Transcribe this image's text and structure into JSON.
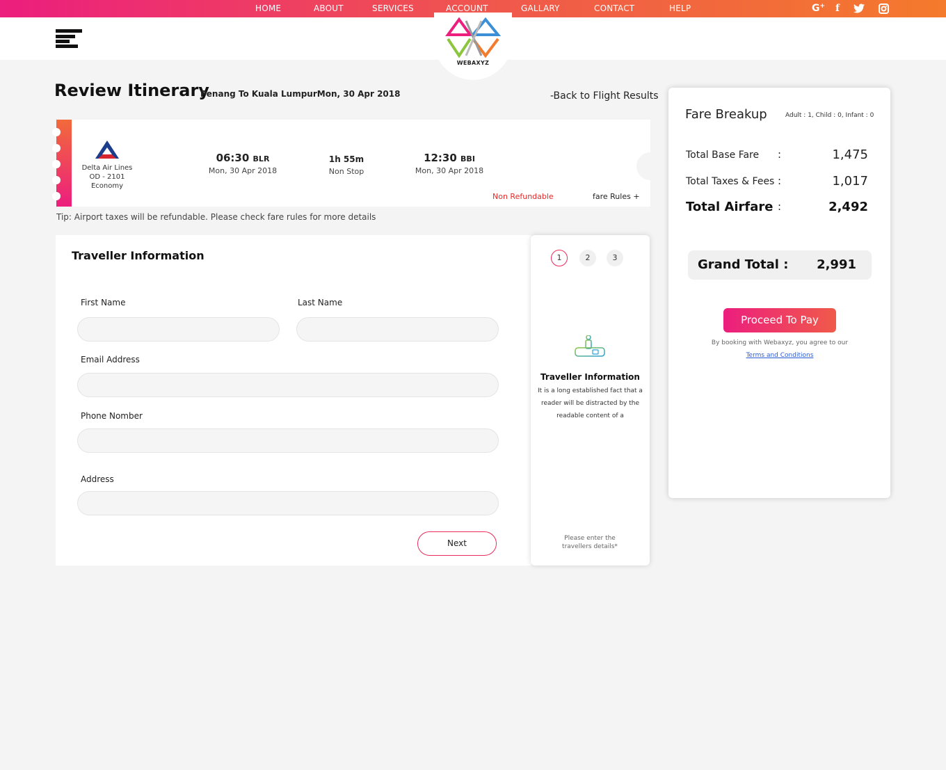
{
  "nav": {
    "items": [
      "HOME",
      "ABOUT",
      "SERVICES",
      "ACCOUNT",
      "GALLARY",
      "CONTACT",
      "HELP"
    ],
    "social": [
      "google-plus-icon",
      "facebook-icon",
      "twitter-icon",
      "instagram-icon"
    ]
  },
  "header": {
    "logo_text": "WEBAXYZ"
  },
  "itinerary": {
    "title": "Review Itinerary",
    "route": "Penang To Kuala LumpurMon, 30 Apr 2018",
    "back_link": "-Back to Flight Results"
  },
  "flight": {
    "airline": "Delta Air Lines",
    "flight_no": "OD - 2101",
    "cabin": "Economy",
    "depart_time": "06:30",
    "depart_code": "BLR",
    "depart_date": "Mon, 30 Apr 2018",
    "duration": "1h 55m",
    "stops": "Non Stop",
    "arrive_time": "12:30",
    "arrive_code": "BBI",
    "arrive_date": "Mon, 30 Apr 2018",
    "refund_status": "Non Refundable",
    "fare_rules": "fare Rules +"
  },
  "tip": "Tip: Airport taxes will be refundable. Please check fare rules for more details",
  "traveller_form": {
    "title": "Traveller Information",
    "first_name_label": "First Name",
    "last_name_label": "Last Name",
    "email_label": "Email Address",
    "phone_label": "Phone Nomber",
    "address_label": "Address",
    "next_label": "Next"
  },
  "steps": {
    "numbers": [
      "1",
      "2",
      "3"
    ],
    "active": 1,
    "title": "Traveller Information",
    "desc": "It is a long established fact that a reader will be distracted by the readable content of a",
    "note": "Please enter the travellers details*"
  },
  "fare": {
    "title": "Fare Breakup",
    "pax": "Adult : 1, Child : 0, Infant : 0",
    "rows": [
      {
        "label": "Total Base Fare",
        "value": "1,475"
      },
      {
        "label": "Total Taxes & Fees",
        "value": "1,017"
      },
      {
        "label": "Total Airfare",
        "value": "2,492"
      }
    ],
    "colon": ":",
    "grand_label": "Grand Total :",
    "grand_value": "2,991",
    "pay_label": "Proceed To Pay",
    "agree_text": "By booking with Webaxyz, you agree to our",
    "terms_label": "Terms and Conditions"
  },
  "colors": {
    "accent_pink": "#ec1e7e",
    "accent_orange": "#f47a2c",
    "refund_red": "#e52a2a",
    "link_blue": "#2a5bd7"
  }
}
